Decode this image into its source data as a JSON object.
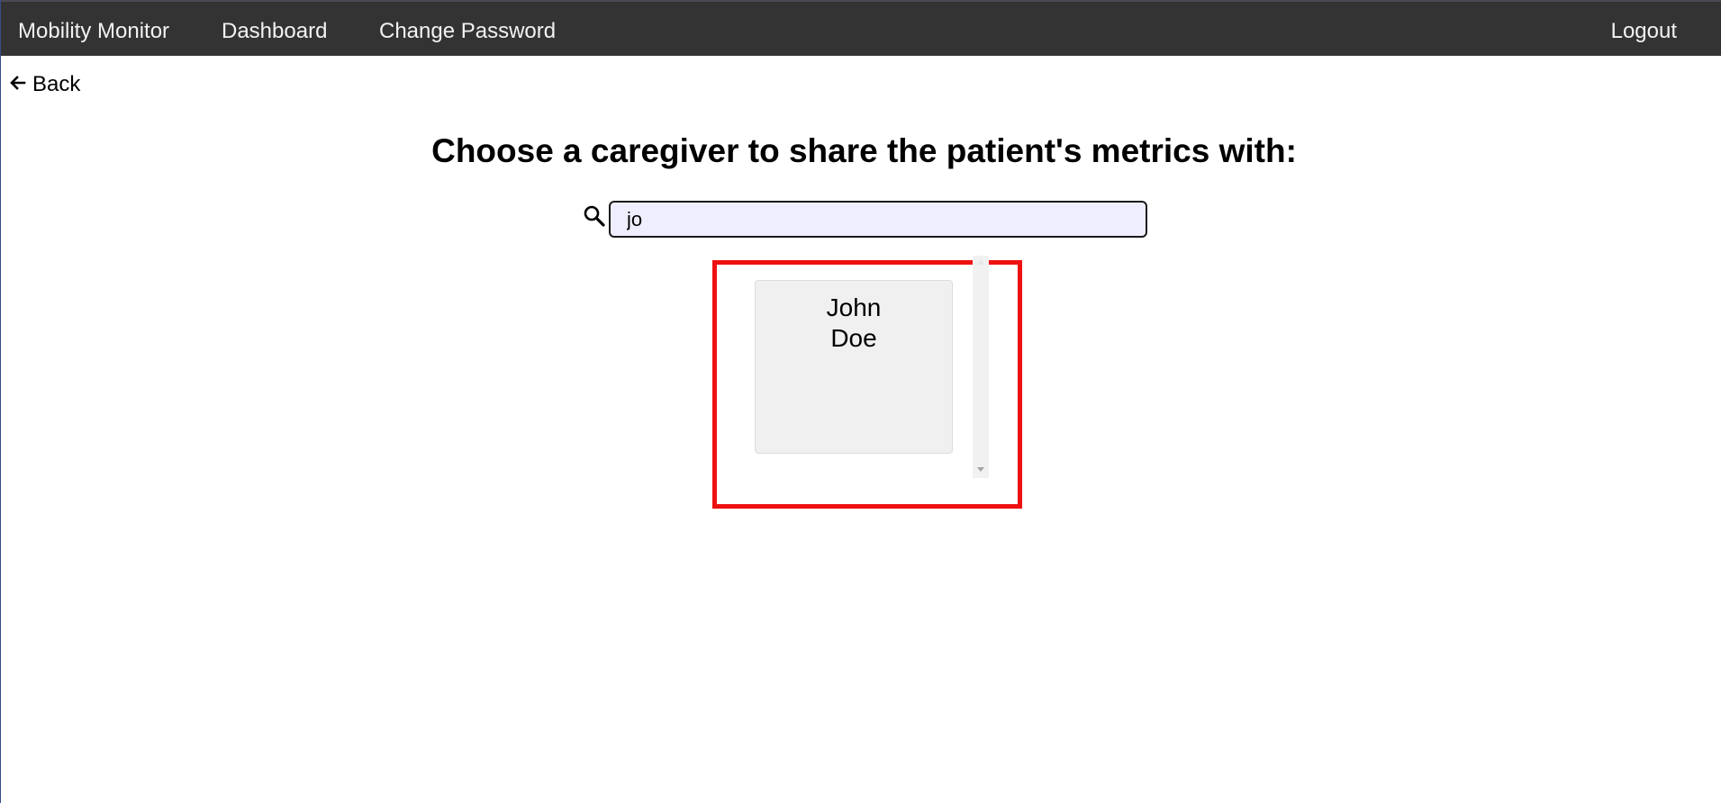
{
  "nav": {
    "brand": "Mobility Monitor",
    "dashboard": "Dashboard",
    "change_password": "Change Password",
    "logout": "Logout"
  },
  "back": {
    "label": "Back",
    "icon": "arrow-left-icon"
  },
  "heading": "Choose a caregiver to share the patient's metrics with:",
  "search": {
    "icon": "search-icon",
    "value": "jo",
    "placeholder": ""
  },
  "results": [
    {
      "first_name": "John",
      "last_name": "Doe"
    }
  ],
  "colors": {
    "navbar": "#333333",
    "highlight_frame": "#ee1111",
    "search_bg": "#eeeefe",
    "card_bg": "#f0f0f0"
  }
}
